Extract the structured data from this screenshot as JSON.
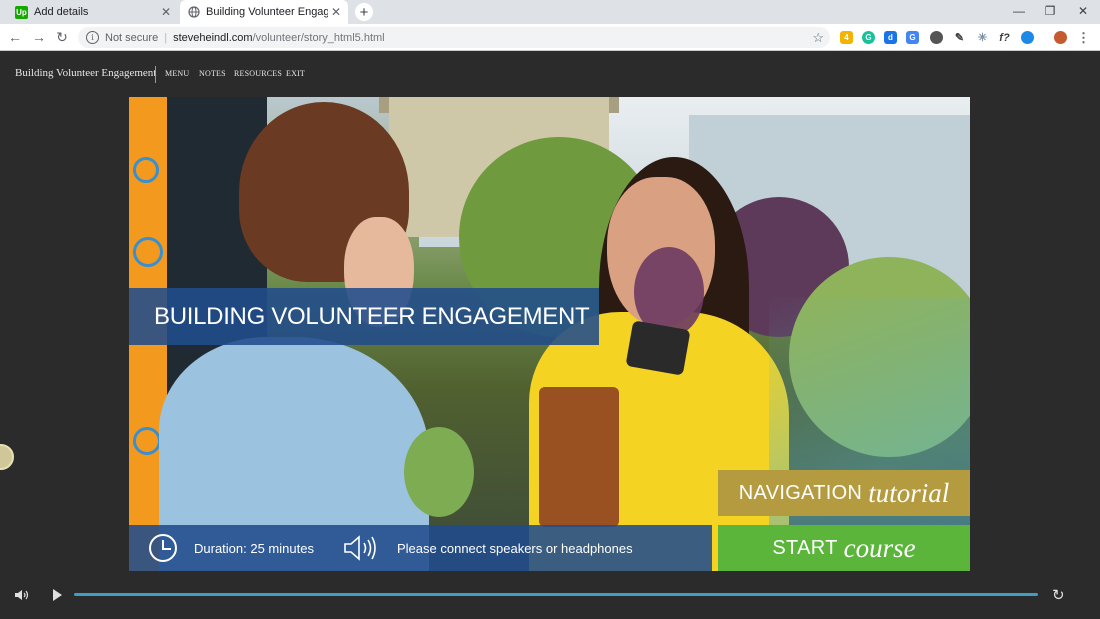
{
  "browser": {
    "tabs": [
      {
        "title": "Add details",
        "favicon": "Up",
        "favicon_color": "#14a800",
        "active": false
      },
      {
        "title": "Building Volunteer Engagement",
        "favicon": "globe-icon",
        "active": true
      }
    ],
    "address": {
      "security_label": "Not secure",
      "host": "steveheindl.com",
      "path": "/volunteer/story_html5.html"
    },
    "window_buttons": [
      "minimize-icon",
      "restore-icon",
      "close-icon"
    ],
    "extensions": [
      {
        "name": "sticky-notes-extension-icon",
        "color": "#f2b400",
        "label": "4"
      },
      {
        "name": "grammarly-extension-icon",
        "color": "#15c39a",
        "label": "G"
      },
      {
        "name": "dashlane-extension-icon",
        "color": "#1a73e8",
        "label": "d"
      },
      {
        "name": "translate-extension-icon",
        "color": "#4285f4",
        "label": "G"
      },
      {
        "name": "circle-extension-icon",
        "color": "#555555",
        "label": ""
      },
      {
        "name": "eyedropper-extension-icon",
        "color": "#3c4043",
        "label": ""
      },
      {
        "name": "network-extension-icon",
        "color": "#7b8fa6",
        "label": ""
      },
      {
        "name": "function-extension-icon",
        "color": "#3c4043",
        "label": "f?"
      },
      {
        "name": "cortana-extension-icon",
        "color": "#1e88e5",
        "label": ""
      }
    ]
  },
  "player": {
    "course_title": "Building Volunteer Engagement",
    "menu": [
      "MENU",
      "NOTES",
      "RESOURCES",
      "EXIT"
    ],
    "progress": 0
  },
  "slide": {
    "title": "BUILDING VOLUNTEER ENGAGEMENT",
    "duration": "Duration: 25 minutes",
    "speakers_note": "Please connect speakers or headphones",
    "nav_button": {
      "main": "NAVIGATION",
      "em": "tutorial",
      "color": "#b59b3f"
    },
    "start_button": {
      "main": "START",
      "em": "course",
      "color": "#5ab53a"
    },
    "band_color": "#214c8c"
  }
}
